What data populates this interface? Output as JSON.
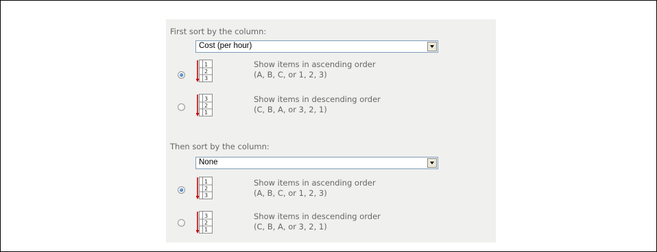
{
  "sort_panel": {
    "first": {
      "label": "First sort by the column:",
      "selected_value": "Cost (per hour)",
      "ascending": {
        "title": "Show items in ascending order",
        "hint": "(A, B, C, or 1, 2, 3)",
        "checked": true,
        "icon": "sort-ascending-icon",
        "digits": [
          "1",
          "2",
          "3"
        ]
      },
      "descending": {
        "title": "Show items in descending order",
        "hint": "(C, B, A, or 3, 2, 1)",
        "checked": false,
        "icon": "sort-descending-icon",
        "digits": [
          "3",
          "2",
          "1"
        ]
      }
    },
    "second": {
      "label": "Then sort by the column:",
      "selected_value": "None",
      "ascending": {
        "title": "Show items in ascending order",
        "hint": "(A, B, C, or 1, 2, 3)",
        "checked": true,
        "icon": "sort-ascending-icon",
        "digits": [
          "1",
          "2",
          "3"
        ]
      },
      "descending": {
        "title": "Show items in descending order",
        "hint": "(C, B, A, or 3, 2, 1)",
        "checked": false,
        "icon": "sort-descending-icon",
        "digits": [
          "3",
          "2",
          "1"
        ]
      }
    }
  },
  "colors": {
    "panel_bg": "#f0f0ee",
    "label_text": "#666666",
    "arrow": "#cc0000",
    "radio_selected": "#1c5aa8"
  }
}
